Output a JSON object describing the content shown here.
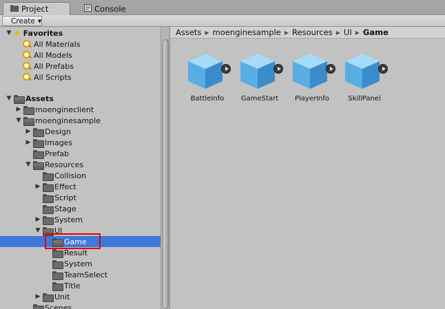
{
  "tabs": [
    {
      "label": "Project",
      "icon": "folder-icon",
      "active": true
    },
    {
      "label": "Console",
      "icon": "console-icon",
      "active": false
    }
  ],
  "toolbar": {
    "create_label": "Create"
  },
  "tree": {
    "favorites_label": "Favorites",
    "favorites": [
      "All Materials",
      "All Models",
      "All Prefabs",
      "All Scripts"
    ],
    "assets_label": "Assets",
    "items": {
      "moenginesclient": "moengineclient",
      "moenginesample": "moenginesample",
      "design": "Design",
      "images": "Images",
      "prefab": "Prefab",
      "resources": "Resources",
      "collision": "Collision",
      "effect": "Effect",
      "script": "Script",
      "stage": "Stage",
      "system": "System",
      "ui": "UI",
      "game": "Game",
      "result": "Result",
      "ui_system": "System",
      "teamselect": "TeamSelect",
      "title": "Title",
      "unit": "Unit",
      "scenes": "Scenes"
    },
    "selected": "Game"
  },
  "breadcrumb": [
    "Assets",
    "moenginesample",
    "Resources",
    "UI",
    "Game"
  ],
  "assets": [
    "BattleInfo",
    "GameStart",
    "PlayerInfo",
    "SkillPanel"
  ],
  "colors": {
    "selection": "#3d78db",
    "highlight_box": "#e00000",
    "cube": "#5aaee0"
  }
}
